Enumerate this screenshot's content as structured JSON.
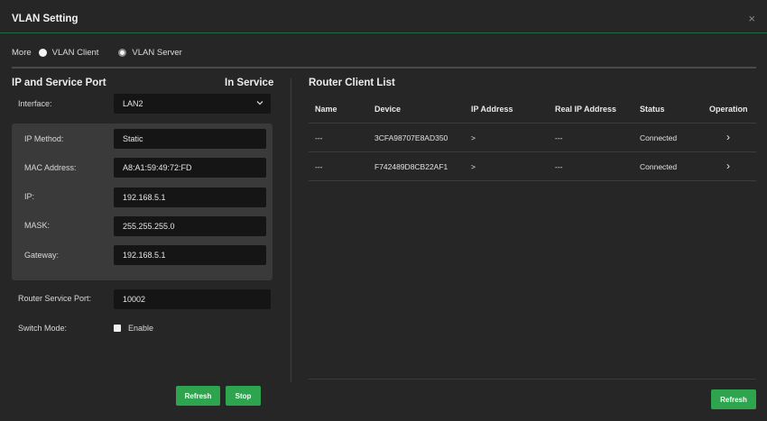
{
  "window": {
    "title": "VLAN Setting",
    "close_glyph": "×"
  },
  "mode": {
    "label": "More",
    "options": [
      {
        "label": "VLAN Client",
        "selected": false
      },
      {
        "label": "VLAN Server",
        "selected": true
      }
    ]
  },
  "left": {
    "title": "IP and Service Port",
    "status": "In Service",
    "interface": {
      "label": "Interface:",
      "value": "LAN2"
    },
    "ip_method": {
      "label": "IP Method:",
      "value": "Static"
    },
    "mac": {
      "label": "MAC Address:",
      "value": "A8:A1:59:49:72:FD"
    },
    "ip": {
      "label": "IP:",
      "value": "192.168.5.1"
    },
    "mask": {
      "label": "MASK:",
      "value": "255.255.255.0"
    },
    "gateway": {
      "label": "Gateway:",
      "value": "192.168.5.1"
    },
    "service_port": {
      "label": "Router Service Port:",
      "value": "10002"
    },
    "switch_mode": {
      "label": "Switch Mode:",
      "checkbox_label": "Enable",
      "checked": false
    },
    "refresh_label": "Refresh",
    "stop_label": "Stop"
  },
  "right": {
    "title": "Router Client List",
    "columns": [
      "Name",
      "Device",
      "IP Address",
      "Real IP Address",
      "Status",
      "Operation"
    ],
    "rows": [
      {
        "name": "---",
        "device": "3CFA98707E8AD350",
        "ip": ">",
        "real_ip": "---",
        "status": "Connected",
        "op": "›"
      },
      {
        "name": "---",
        "device": "F742489D8CB22AF1",
        "ip": ">",
        "real_ip": "---",
        "status": "Connected",
        "op": "›"
      }
    ],
    "refresh_label": "Refresh"
  },
  "colors": {
    "accent": "#2ea44f",
    "background": "#262626",
    "field": "#151515",
    "panel": "#3a3a3a"
  }
}
